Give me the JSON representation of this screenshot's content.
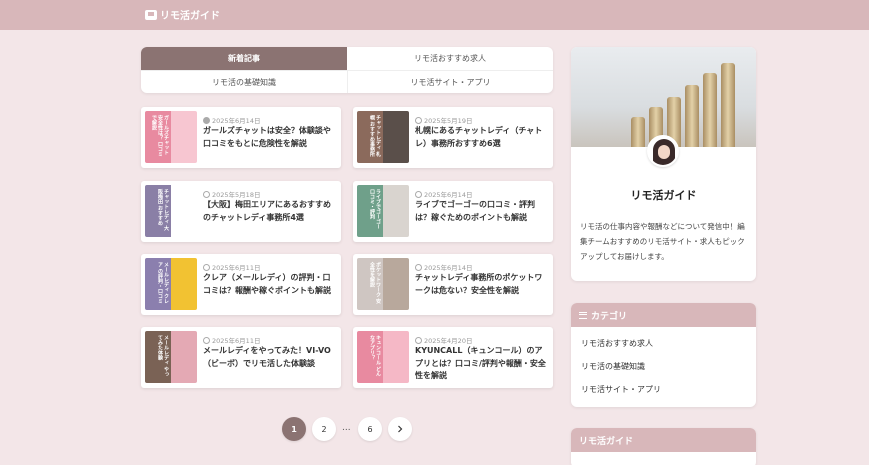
{
  "header": {
    "logo_text": "リモ活ガイド"
  },
  "tabs": [
    {
      "label": "新着記事",
      "active": true
    },
    {
      "label": "リモ活おすすめ求人",
      "active": false
    },
    {
      "label": "リモ活の基礎知識",
      "active": false
    },
    {
      "label": "リモ活サイト・アプリ",
      "active": false
    }
  ],
  "cards": [
    {
      "date": "2025年6月14日",
      "icon": "clock-icon",
      "title": "ガールズチャットは安全？体験談や口コミをもとに危険性を解説",
      "thumb_text": "ガールズチャット 安全性は？ 口コミで解説",
      "band_color": "#e88aa0",
      "photo_color": "#f7c6d1"
    },
    {
      "date": "2025年5月19日",
      "icon": "refresh-icon",
      "title": "札幌にあるチャットレディ（チャトレ）事務所おすすめ6選",
      "thumb_text": "チャットレディ 札幌 おすすめ事務所",
      "band_color": "#8b6a5c",
      "photo_color": "#5a4f4a"
    },
    {
      "date": "2025年5月18日",
      "icon": "refresh-icon",
      "title": "【大阪】梅田エリアにあるおすすめのチャットレディ事務所4選",
      "thumb_text": "チャットレディ 大阪梅田 おすすめ",
      "band_color": "#8a7fa6",
      "photo_color": "#ffffff"
    },
    {
      "date": "2025年6月14日",
      "icon": "refresh-icon",
      "title": "ライブでゴーゴーの口コミ・評判は？稼ぐためのポイントも解説",
      "thumb_text": "ライブでゴーゴー 口コミ・評判",
      "band_color": "#6fa08a",
      "photo_color": "#d9d4cf"
    },
    {
      "date": "2025年6月11日",
      "icon": "refresh-icon",
      "title": "クレア（メールレディ）の評判・口コミは？報酬や稼ぐポイントも解説",
      "thumb_text": "メールレディ クレア の評判・口コミ",
      "band_color": "#8b7fae",
      "photo_color": "#f2c232"
    },
    {
      "date": "2025年6月14日",
      "icon": "refresh-icon",
      "title": "チャットレディ事務所のポケットワークは危ない？安全性を解説",
      "thumb_text": "ポケットワーク 安全性を解説",
      "band_color": "#cfc6c2",
      "photo_color": "#b8a89c"
    },
    {
      "date": "2025年6月11日",
      "icon": "refresh-icon",
      "title": "メールレディをやってみた！VI-VO（ビーボ）でリモ活した体験談",
      "thumb_text": "メールレディ やってみた体験",
      "band_color": "#7a6255",
      "photo_color": "#e4a9b4"
    },
    {
      "date": "2025年4月20日",
      "icon": "refresh-icon",
      "title": "KYUNCALL（キュンコール）のアプリとは？口コミ/評判や報酬・安全性を解説",
      "thumb_text": "キュンコール どんなアプリ？",
      "band_color": "#e88aa0",
      "photo_color": "#f5b8c6"
    }
  ],
  "pagination": {
    "current": "1",
    "page2": "2",
    "ellipsis": "...",
    "last": "6"
  },
  "sidebar": {
    "profile_name": "リモ活ガイド",
    "profile_desc": "リモ活の仕事内容や報酬などについて発信中！編集チームおすすめのリモ活サイト・求人もピックアップしてお届けします。",
    "category_title": "カテゴリ",
    "categories": [
      "リモ活おすすめ求人",
      "リモ活の基礎知識",
      "リモ活サイト・アプリ"
    ],
    "guide_title": "リモ活ガイド"
  },
  "colors": {
    "header": "#d8b7ba",
    "accent": "#8b7372",
    "background": "#f3e6e8"
  }
}
